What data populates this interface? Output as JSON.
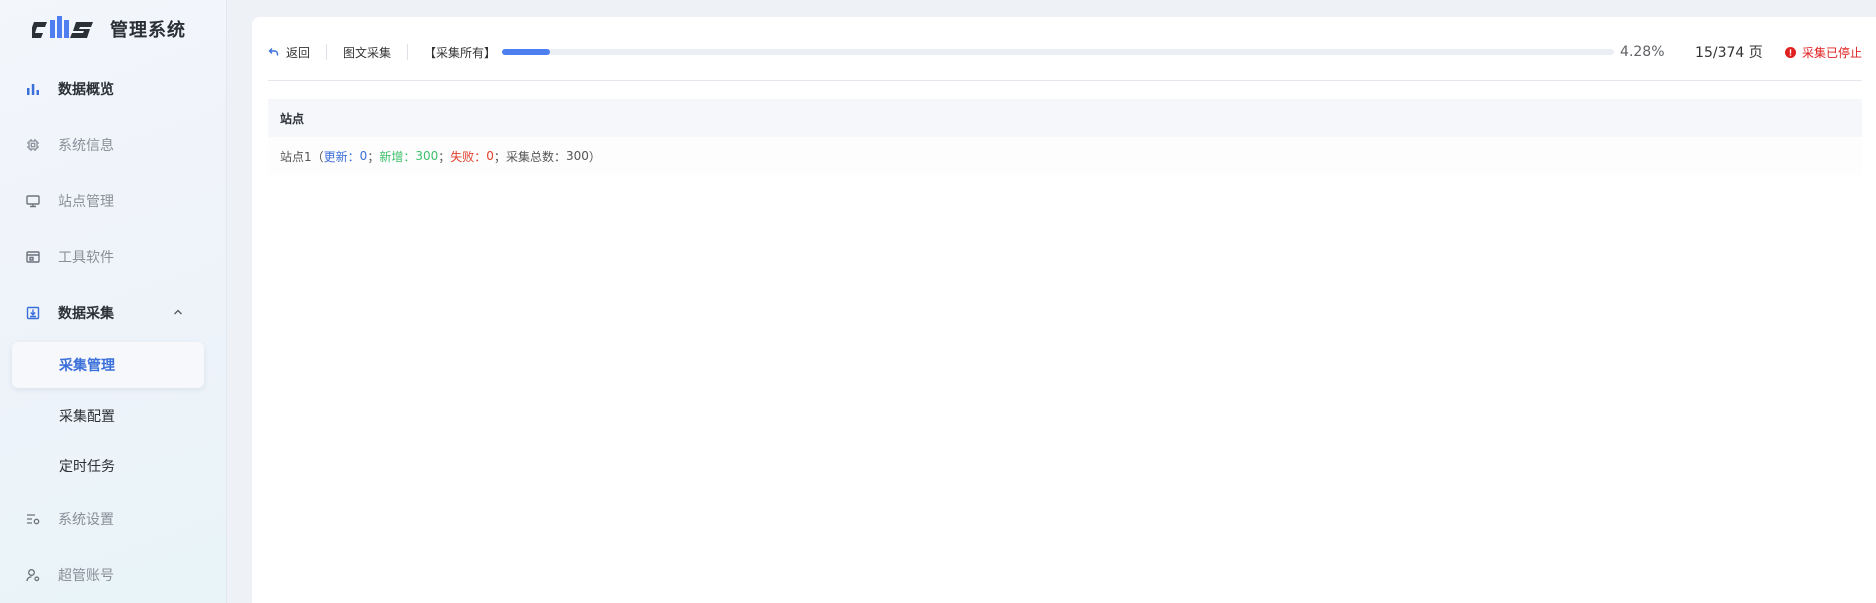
{
  "brand": {
    "logo_alt": "cms",
    "title": "管理系统"
  },
  "sidebar": {
    "items": [
      {
        "label": "数据概览",
        "icon": "bar-chart-icon"
      },
      {
        "label": "系统信息",
        "icon": "chip-icon"
      },
      {
        "label": "站点管理",
        "icon": "monitor-icon"
      },
      {
        "label": "工具软件",
        "icon": "window-icon"
      },
      {
        "label": "数据采集",
        "icon": "download-box-icon"
      },
      {
        "label": "系统设置",
        "icon": "settings-list-icon"
      },
      {
        "label": "超管账号",
        "icon": "user-gear-icon"
      }
    ],
    "subitems": [
      {
        "label": "采集管理"
      },
      {
        "label": "采集配置"
      },
      {
        "label": "定时任务"
      }
    ]
  },
  "topbar": {
    "back_label": "返回",
    "breadcrumb": "图文采集",
    "task_tag": "【采集所有】",
    "progress": 0.0428,
    "percent_text": "4.28%",
    "pages_text": "15/374 页",
    "status_text": "采集已停止"
  },
  "table": {
    "header": "站点",
    "rows": [
      {
        "site": "站点1",
        "open": "（",
        "updated_label": "更新：",
        "updated_value": "0",
        "sep1": "；",
        "new_label": "新增：",
        "new_value": "300",
        "sep2": "；",
        "failed_label": "失败：",
        "failed_value": "0",
        "sep3": "；",
        "total_label": "采集总数：",
        "total_value": "300",
        "close": "）"
      }
    ]
  },
  "colors": {
    "accent": "#3b6fd9",
    "progress": "#4e7ff0",
    "success": "#3cbf6a",
    "danger": "#e02020"
  }
}
